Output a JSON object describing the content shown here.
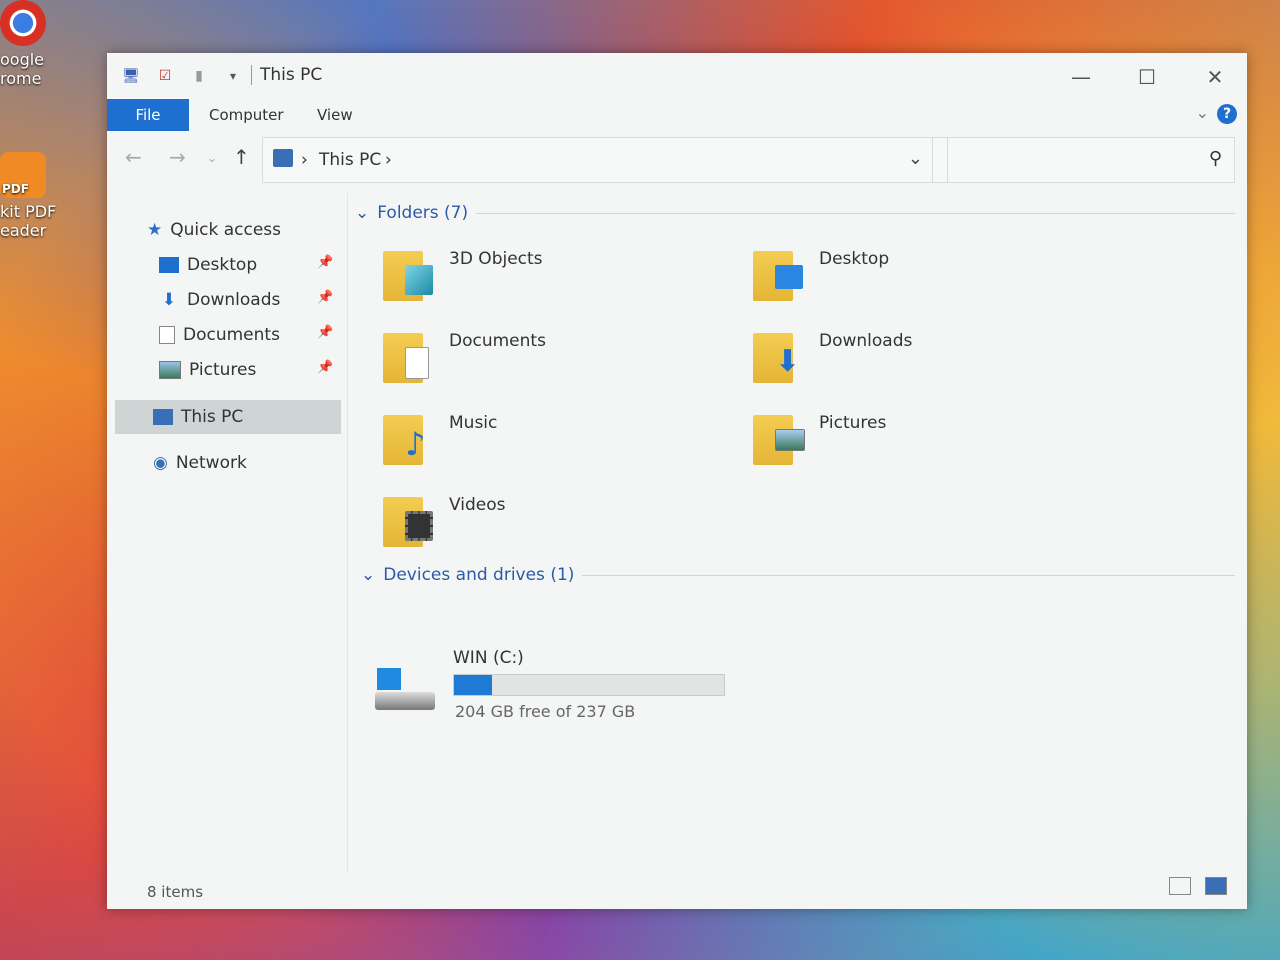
{
  "desktop": {
    "icons": [
      {
        "label_line1": "oogle",
        "label_line2": "rome",
        "icon": "chrome-icon"
      },
      {
        "label_line1": "kit PDF",
        "label_line2": "eader",
        "icon": "foxit-pdf-icon",
        "badge": "PDF"
      }
    ]
  },
  "window": {
    "title": "This PC",
    "controls": {
      "minimize": "—",
      "maximize": "☐",
      "close": "✕"
    },
    "ribbon_tabs": [
      "File",
      "Computer",
      "View"
    ],
    "help_label": "?",
    "address": {
      "crumbs": [
        "This PC"
      ],
      "separator": "›"
    },
    "search": {
      "placeholder": ""
    },
    "nav": {
      "quick_access": "Quick access",
      "items": [
        {
          "label": "Desktop",
          "icon": "desktop-icon",
          "pinned": true
        },
        {
          "label": "Downloads",
          "icon": "downloads-icon",
          "pinned": true
        },
        {
          "label": "Documents",
          "icon": "documents-icon",
          "pinned": true
        },
        {
          "label": "Pictures",
          "icon": "pictures-icon",
          "pinned": true
        }
      ],
      "this_pc": "This PC",
      "network": "Network"
    },
    "folders_header": "Folders (7)",
    "folders": [
      {
        "label": "3D Objects",
        "icon": "3d-objects-icon"
      },
      {
        "label": "Desktop",
        "icon": "desktop-folder-icon"
      },
      {
        "label": "Documents",
        "icon": "documents-folder-icon"
      },
      {
        "label": "Downloads",
        "icon": "downloads-folder-icon"
      },
      {
        "label": "Music",
        "icon": "music-folder-icon"
      },
      {
        "label": "Pictures",
        "icon": "pictures-folder-icon"
      },
      {
        "label": "Videos",
        "icon": "videos-folder-icon"
      }
    ],
    "drives_header": "Devices and drives (1)",
    "drive": {
      "label": "WIN (C:)",
      "free_text": "204 GB free of 237 GB",
      "used_fraction": 0.14,
      "bar_color": "#1f7ad6"
    },
    "status": "8 items"
  }
}
